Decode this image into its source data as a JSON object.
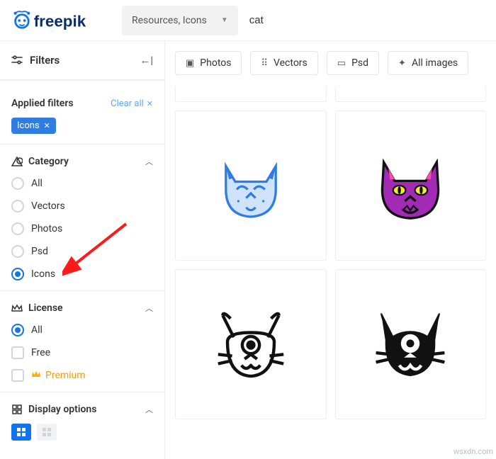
{
  "header": {
    "brand": "freepik",
    "resources_label": "Resources, Icons",
    "search_value": "cat"
  },
  "filters_header": {
    "title": "Filters"
  },
  "applied": {
    "title": "Applied filters",
    "clear_label": "Clear all",
    "chips": [
      "Icons"
    ]
  },
  "category": {
    "title": "Category",
    "options": [
      "All",
      "Vectors",
      "Photos",
      "Psd",
      "Icons"
    ],
    "selected": "Icons"
  },
  "license": {
    "title": "License",
    "all": "All",
    "free": "Free",
    "premium": "Premium",
    "selected": "All"
  },
  "display": {
    "title": "Display options"
  },
  "content_filters": {
    "photos": "Photos",
    "vectors": "Vectors",
    "psd": "Psd",
    "all_images": "All images"
  },
  "watermark": "wsxdn.com"
}
